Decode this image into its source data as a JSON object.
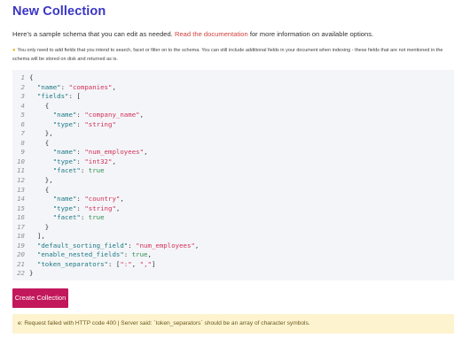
{
  "page": {
    "title": "New Collection"
  },
  "intro": {
    "before": "Here's a sample schema that you can edit as needed. ",
    "link": "Read the documentation",
    "after": " for more information on available options."
  },
  "hint": {
    "icon": "lightbulb-icon",
    "text": "You only need to add fields that you intend to search, facet or filter on to the schema. You can still include additional fields in your document when indexing - these fields that are not mentioned in the schema will be stored on disk and returned as is."
  },
  "schema_editor": {
    "lines": [
      [
        [
          "p",
          "{"
        ]
      ],
      [
        [
          "p",
          "  "
        ],
        [
          "k",
          "\"name\""
        ],
        [
          "p",
          ": "
        ],
        [
          "s",
          "\"companies\""
        ],
        [
          "p",
          ","
        ]
      ],
      [
        [
          "p",
          "  "
        ],
        [
          "k",
          "\"fields\""
        ],
        [
          "p",
          ": ["
        ]
      ],
      [
        [
          "p",
          "    {"
        ]
      ],
      [
        [
          "p",
          "      "
        ],
        [
          "k",
          "\"name\""
        ],
        [
          "p",
          ": "
        ],
        [
          "s",
          "\"company_name\""
        ],
        [
          "p",
          ","
        ]
      ],
      [
        [
          "p",
          "      "
        ],
        [
          "k",
          "\"type\""
        ],
        [
          "p",
          ": "
        ],
        [
          "s",
          "\"string\""
        ]
      ],
      [
        [
          "p",
          "    },"
        ]
      ],
      [
        [
          "p",
          "    {"
        ]
      ],
      [
        [
          "p",
          "      "
        ],
        [
          "k",
          "\"name\""
        ],
        [
          "p",
          ": "
        ],
        [
          "s",
          "\"num_employees\""
        ],
        [
          "p",
          ","
        ]
      ],
      [
        [
          "p",
          "      "
        ],
        [
          "k",
          "\"type\""
        ],
        [
          "p",
          ": "
        ],
        [
          "s",
          "\"int32\""
        ],
        [
          "p",
          ","
        ]
      ],
      [
        [
          "p",
          "      "
        ],
        [
          "k",
          "\"facet\""
        ],
        [
          "p",
          ": "
        ],
        [
          "b",
          "true"
        ]
      ],
      [
        [
          "p",
          "    },"
        ]
      ],
      [
        [
          "p",
          "    {"
        ]
      ],
      [
        [
          "p",
          "      "
        ],
        [
          "k",
          "\"name\""
        ],
        [
          "p",
          ": "
        ],
        [
          "s",
          "\"country\""
        ],
        [
          "p",
          ","
        ]
      ],
      [
        [
          "p",
          "      "
        ],
        [
          "k",
          "\"type\""
        ],
        [
          "p",
          ": "
        ],
        [
          "s",
          "\"string\""
        ],
        [
          "p",
          ","
        ]
      ],
      [
        [
          "p",
          "      "
        ],
        [
          "k",
          "\"facet\""
        ],
        [
          "p",
          ": "
        ],
        [
          "b",
          "true"
        ]
      ],
      [
        [
          "p",
          "    }"
        ]
      ],
      [
        [
          "p",
          "  ],"
        ]
      ],
      [
        [
          "p",
          "  "
        ],
        [
          "k",
          "\"default_sorting_field\""
        ],
        [
          "p",
          ": "
        ],
        [
          "s",
          "\"num_employees\""
        ],
        [
          "p",
          ","
        ]
      ],
      [
        [
          "p",
          "  "
        ],
        [
          "k",
          "\"enable_nested_fields\""
        ],
        [
          "p",
          ": "
        ],
        [
          "b",
          "true"
        ],
        [
          "p",
          ","
        ]
      ],
      [
        [
          "p",
          "  "
        ],
        [
          "k",
          "\"token_separators\""
        ],
        [
          "p",
          ": ["
        ],
        [
          "s",
          "\":\""
        ],
        [
          "p",
          ", "
        ],
        [
          "s",
          "\",\""
        ],
        [
          "p",
          "]"
        ]
      ],
      [
        [
          "p",
          "}"
        ]
      ]
    ]
  },
  "actions": {
    "create_label": "Create Collection"
  },
  "error": {
    "message": "e: Request failed with HTTP code 400 | Server said: `token_separators` should be an array of character symbols."
  },
  "colors": {
    "title": "#3a35c4",
    "link": "#d0433f",
    "button": "#c2185b",
    "error_bg": "#fdf3cf"
  }
}
